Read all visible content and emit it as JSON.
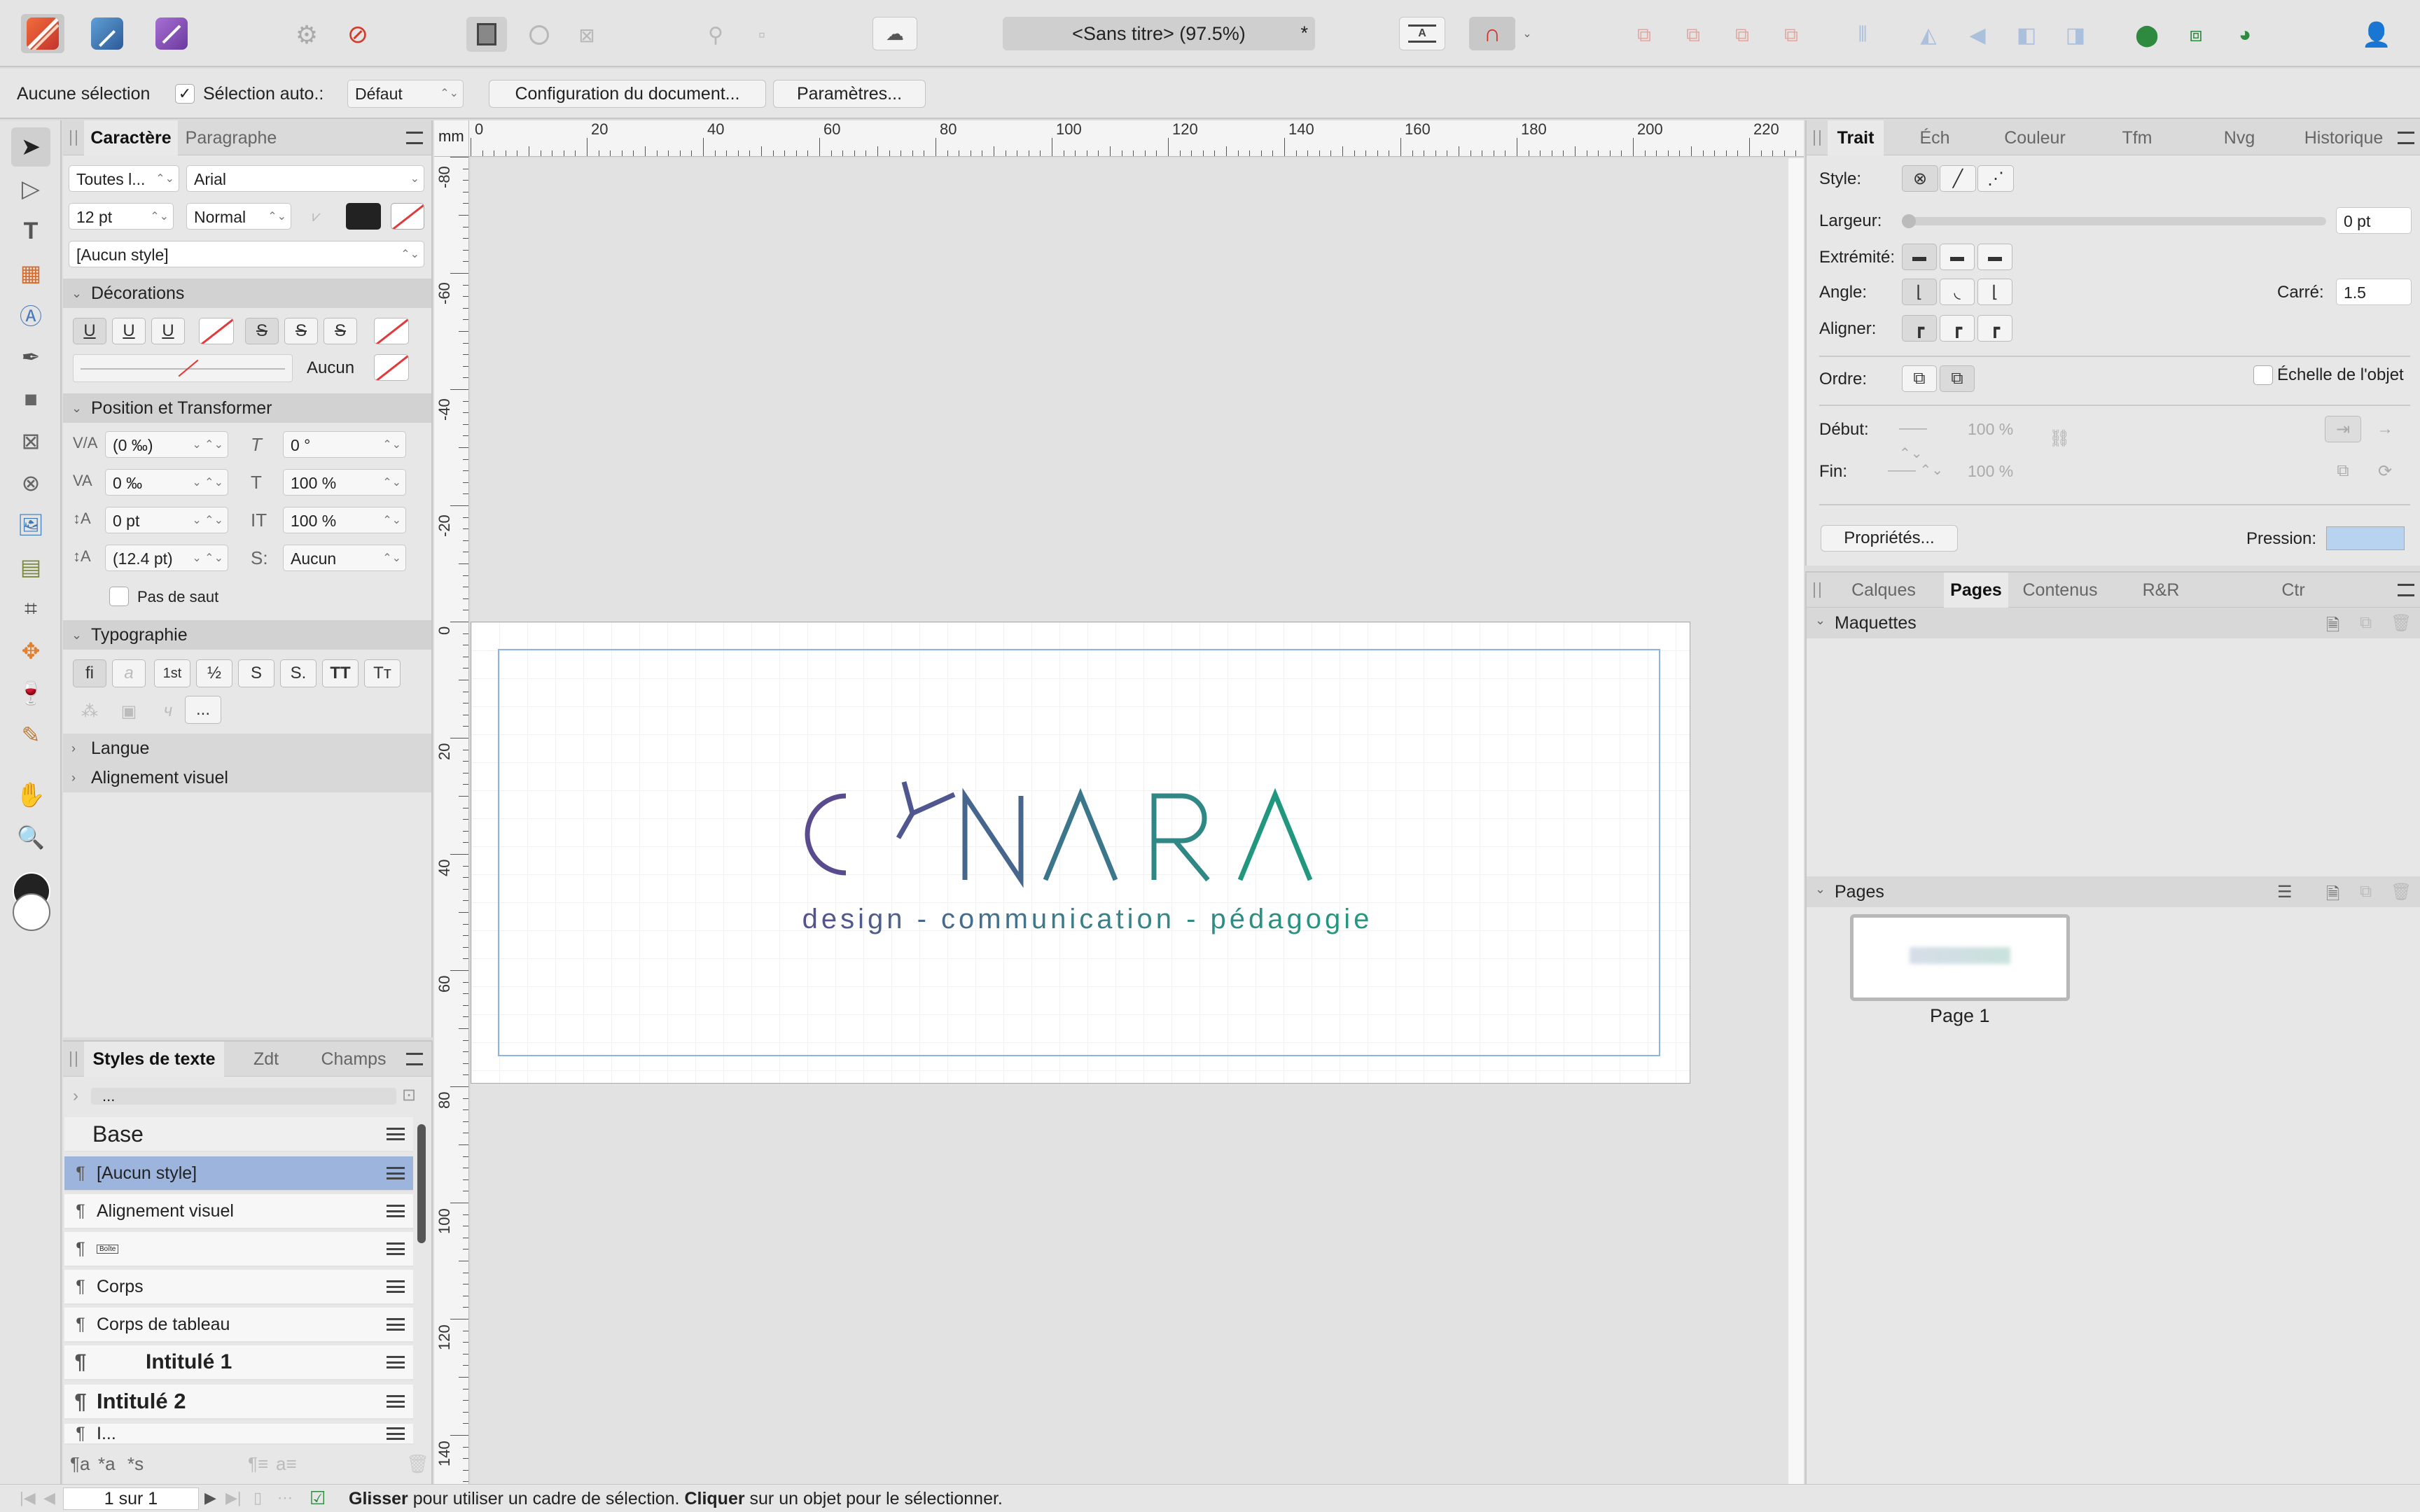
{
  "title": "<Sans titre> (97.5%)",
  "title_modified": "*",
  "context_toolbar": {
    "selection_label": "Aucune sélection",
    "auto_select_label": "Sélection auto.:",
    "auto_select_value": "Défaut",
    "doc_setup_button": "Configuration du document...",
    "prefs_button": "Paramètres..."
  },
  "left_panel": {
    "tabs": [
      "Caractère",
      "Paragraphe"
    ],
    "font_collection": "Toutes l...",
    "font_family": "Arial",
    "font_size": "12 pt",
    "font_style": "Normal",
    "char_style": "[Aucun style]",
    "sections": {
      "decorations": "Décorations",
      "position": "Position et Transformer",
      "typography": "Typographie",
      "language": "Langue",
      "visual_alignment": "Alignement visuel"
    },
    "decoration_none": "Aucun",
    "fields": {
      "kerning": "(0 ‰)",
      "shear": "0 °",
      "tracking": "0 ‰",
      "vscale": "100 %",
      "baseline": "0 pt",
      "hscale": "100 %",
      "leading": "(12.4 pt)",
      "lang_opt": "Aucun"
    },
    "no_break_label": "Pas de saut",
    "typo_buttons": [
      "fi",
      "a",
      "1st",
      "½",
      "S",
      "S.",
      "TT",
      "Tт"
    ],
    "typo_more": "..."
  },
  "styles_panel": {
    "tabs": [
      "Styles de texte",
      "Zdt",
      "Champs"
    ],
    "filter_text": "...",
    "items": [
      {
        "label": "Base"
      },
      {
        "label": "[Aucun style]"
      },
      {
        "label": "Alignement visuel"
      },
      {
        "label": "Boîte"
      },
      {
        "label": "Corps"
      },
      {
        "label": "Corps de tableau"
      },
      {
        "label": "Intitulé 1"
      },
      {
        "label": "Intitulé 2"
      },
      {
        "label": "I..."
      }
    ],
    "bottom_icons": [
      "¶a",
      "*a",
      "*s"
    ]
  },
  "ruler": {
    "unit": "mm",
    "h_ticks": [
      "0",
      "20",
      "40",
      "60",
      "80",
      "100",
      "120",
      "140",
      "160",
      "180",
      "200",
      "220"
    ],
    "v_ticks": [
      "-80",
      "-60",
      "-40",
      "-20",
      "0",
      "20",
      "40",
      "60",
      "80",
      "100",
      "120",
      "140"
    ]
  },
  "canvas": {
    "logo_text": "C  NARA",
    "tagline": "design - communication - pédagogie",
    "logo_colors": [
      "#5a4a8e",
      "#3a7f8a",
      "#1f9d7e"
    ]
  },
  "stroke_panel": {
    "tabs": [
      "Trait",
      "Éch",
      "Couleur",
      "Tfm",
      "Nvg",
      "Historique"
    ],
    "style_label": "Style:",
    "width_label": "Largeur:",
    "width_value": "0 pt",
    "cap_label": "Extrémité:",
    "join_label": "Angle:",
    "miter_label": "Carré:",
    "miter_value": "1.5",
    "align_label": "Aligner:",
    "order_label": "Ordre:",
    "scale_label": "Échelle de l'objet",
    "start_label": "Début:",
    "start_value": "100 %",
    "end_label": "Fin:",
    "end_value": "100 %",
    "props_button": "Propriétés...",
    "pressure_label": "Pression:"
  },
  "pages_panel": {
    "tabs": [
      "Calques",
      "Pages",
      "Contenus",
      "R&R",
      "Ctr"
    ],
    "masters_label": "Maquettes",
    "pages_label": "Pages",
    "page_name": "Page 1"
  },
  "status_bar": {
    "page_counter": "1 sur 1",
    "hint_bold1": "Glisser",
    "hint_text1": " pour utiliser un cadre de sélection. ",
    "hint_bold2": "Cliquer",
    "hint_text2": " sur un objet pour le sélectionner."
  }
}
